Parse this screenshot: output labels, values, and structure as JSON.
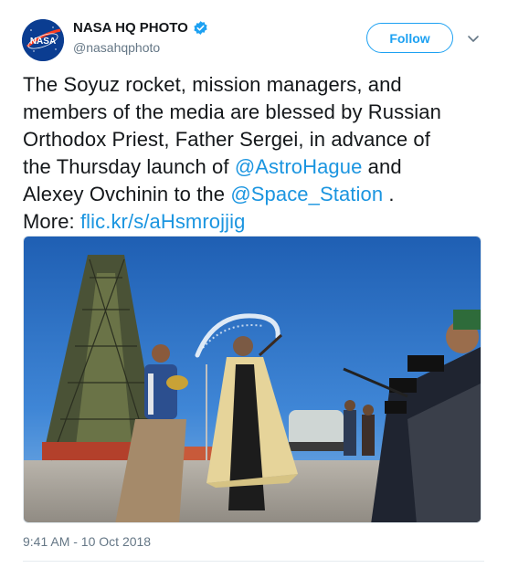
{
  "account": {
    "display_name": "NASA HQ PHOTO",
    "handle": "@nasahqphoto",
    "avatar_text": "NASA",
    "verified": true
  },
  "follow_label": "Follow",
  "tweet": {
    "text_lines": {
      "l1": "The Soyuz rocket, mission managers, and",
      "l2": "members of the media are blessed by Russian",
      "l3": "Orthodox Priest, Father Sergei, in advance of",
      "l4_pre": "the Thursday launch of ",
      "mention1": "@AstroHague",
      "l4_post": " and",
      "l5_pre": "Alexey Ovchinin to the ",
      "mention2": "@Space_Station",
      "l5_post": " .",
      "l6_pre": "More: ",
      "link": "flic.kr/s/aHsmrojjig"
    }
  },
  "timestamp": "9:41 AM - 10 Oct 2018",
  "colors": {
    "link": "#1b95e0",
    "follow": "#1da1f2",
    "secondary_text": "#657786"
  },
  "icons": {
    "verified": "verified-badge-icon",
    "caret": "chevron-down-icon"
  }
}
